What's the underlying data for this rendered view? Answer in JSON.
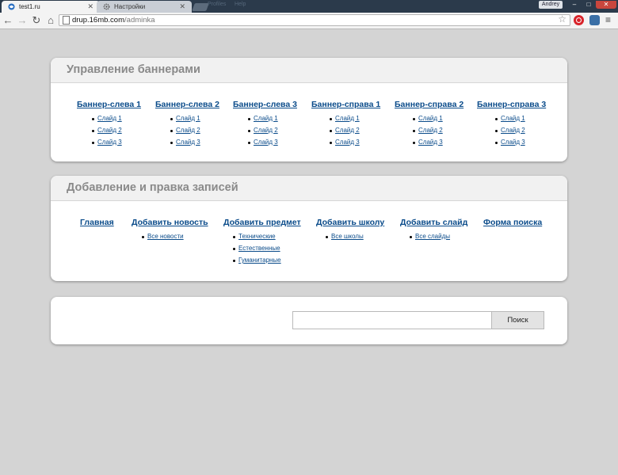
{
  "browser": {
    "tabs": [
      {
        "label": "test1.ru"
      },
      {
        "label": "Настройки"
      }
    ],
    "faded_menu": [
      "Profiles",
      "Help"
    ],
    "user": "Andrey",
    "url": {
      "host": "drup.16mb.com",
      "path": "/adminka"
    }
  },
  "banners": {
    "title": "Управление баннерами",
    "groups": [
      {
        "title": "Баннер-слева 1",
        "items": [
          "Слайд 1",
          "Слайд 2",
          "Слайд 3"
        ]
      },
      {
        "title": "Баннер-слева 2",
        "items": [
          "Слайд 1",
          "Слайд 2",
          "Слайд 3"
        ]
      },
      {
        "title": "Баннер-слева 3",
        "items": [
          "Слайд 1",
          "Слайд 2",
          "Слайд 3"
        ]
      },
      {
        "title": "Баннер-справа 1",
        "items": [
          "Слайд 1",
          "Слайд 2",
          "Слайд 3"
        ]
      },
      {
        "title": "Баннер-справа 2",
        "items": [
          "Слайд 1",
          "Слайд 2",
          "Слайд 3"
        ]
      },
      {
        "title": "Баннер-справа 3",
        "items": [
          "Слайд 1",
          "Слайд 2",
          "Слайд 3"
        ]
      }
    ]
  },
  "records": {
    "title": "Добавление и правка записей",
    "groups": [
      {
        "title": "Главная",
        "items": []
      },
      {
        "title": "Добавить новость",
        "items": [
          "Все новости"
        ]
      },
      {
        "title": "Добавить предмет",
        "items": [
          "Технические",
          "Естественные",
          "Гуманитарные"
        ]
      },
      {
        "title": "Добавить школу",
        "items": [
          "Все школы"
        ]
      },
      {
        "title": "Добавить слайд",
        "items": [
          "Все слайды"
        ]
      },
      {
        "title": "Форма поиска",
        "items": []
      }
    ]
  },
  "search": {
    "value": "",
    "button_label": "Поиск"
  }
}
